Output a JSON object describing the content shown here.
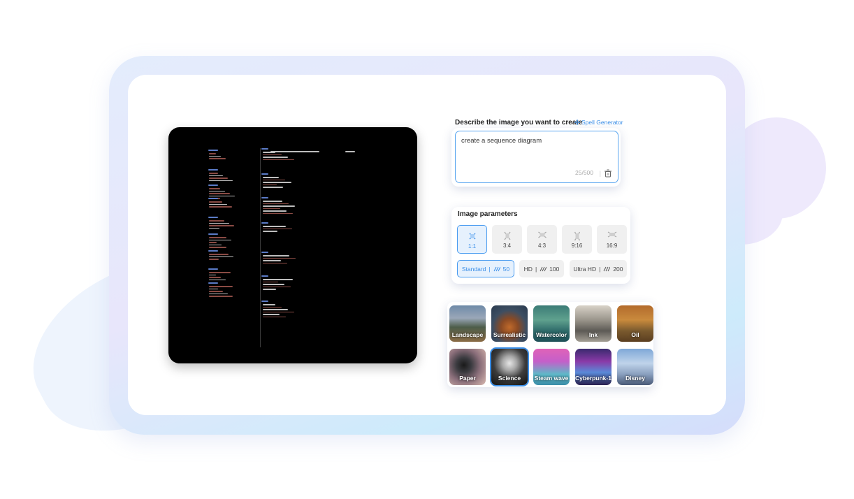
{
  "prompt": {
    "title": "Describe the image you want to create",
    "spell_generator": "Spell Generator",
    "value": "create a sequence diagram",
    "counter": "25/500",
    "separator": "|"
  },
  "params": {
    "title": "Image parameters",
    "ratios": [
      {
        "label": "1:1",
        "selected": true
      },
      {
        "label": "3:4",
        "selected": false
      },
      {
        "label": "4:3",
        "selected": false
      },
      {
        "label": "9:16",
        "selected": false
      },
      {
        "label": "16:9",
        "selected": false
      }
    ],
    "quality": [
      {
        "name": "Standard",
        "sep": "|",
        "cost": "50",
        "selected": true
      },
      {
        "name": "HD",
        "sep": "|",
        "cost": "100",
        "selected": false
      },
      {
        "name": "Ultra HD",
        "sep": "|",
        "cost": "200",
        "selected": false
      }
    ]
  },
  "styles": [
    {
      "label": "Landscape",
      "selected": false
    },
    {
      "label": "Surrealistic",
      "selected": false
    },
    {
      "label": "Watercolor",
      "selected": false
    },
    {
      "label": "Ink",
      "selected": false
    },
    {
      "label": "Oil",
      "selected": false
    },
    {
      "label": "Paper",
      "selected": false
    },
    {
      "label": "Science",
      "selected": true
    },
    {
      "label": "Steam wave",
      "selected": false
    },
    {
      "label": "Cyberpunk-1",
      "selected": false
    },
    {
      "label": "Disney",
      "selected": false
    }
  ],
  "colors": {
    "accent": "#3b8fe8",
    "preview_bg": "#000000"
  }
}
